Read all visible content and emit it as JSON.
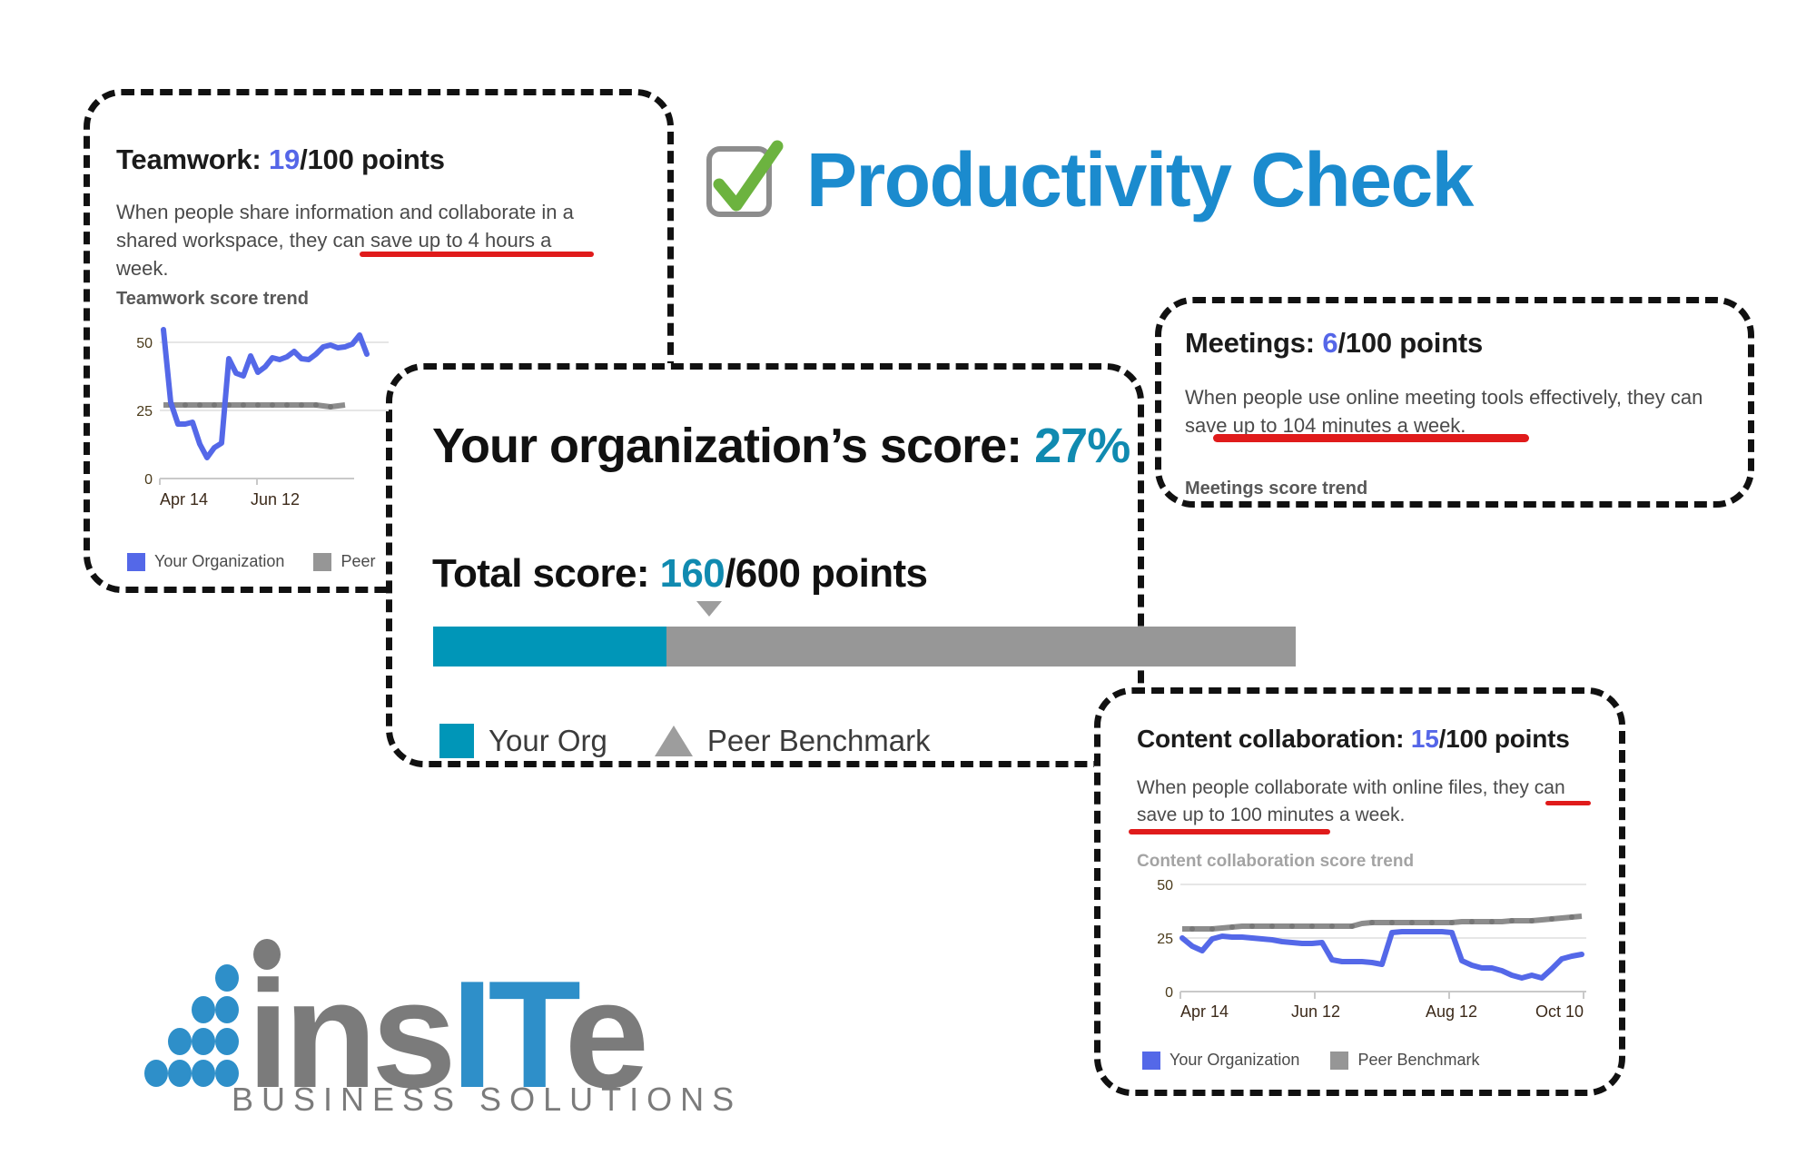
{
  "header": {
    "title": "Productivity Check",
    "title_color": "#1b8bce",
    "check_icon": "checkbox-checked-icon"
  },
  "logo": {
    "name_part1": "ins",
    "name_part2": "IT",
    "name_part3": "e",
    "tagline": "BUSINESS SOLUTIONS",
    "brand_blue": "#2e8fc9",
    "brand_gray": "#7b7b7b"
  },
  "score_panel": {
    "org_score_label": "Your organization’s score:",
    "org_score_value": "27%",
    "total_score_label": "Total score:",
    "total_score_value": "160",
    "total_score_max": "/600 points",
    "bar_fill_percent": 27,
    "bar_marker_percent": 32,
    "bar_fill_color": "#0096b8",
    "bar_rest_color": "#979797",
    "legend": [
      {
        "icon": "square-swatch-icon",
        "label": "Your Org"
      },
      {
        "icon": "triangle-marker-icon",
        "label": "Peer Benchmark"
      }
    ]
  },
  "metrics": [
    {
      "id": "teamwork",
      "title": "Teamwork:",
      "score": "19",
      "max": "/100 points",
      "body_pre": "When people share information and collaborate in a shared workspace, they can ",
      "body_highlight": "save up to 4 hours a week.",
      "trend_label": "Teamwork score trend",
      "legend": [
        {
          "icon": "blue-swatch-icon",
          "label": "Your Organization"
        },
        {
          "icon": "gray-swatch-icon",
          "label": "Peer"
        }
      ]
    },
    {
      "id": "meetings",
      "title": "Meetings:",
      "score": "6",
      "max": "/100 points",
      "body_pre": "When people use online meeting tools effectively, they can save up to ",
      "body_highlight": "104 minutes a week.",
      "trend_label": "Meetings score trend",
      "legend": []
    },
    {
      "id": "content",
      "title": "Content collaboration:",
      "score": "15",
      "max": "/100 points",
      "body_pre": "When people collaborate with online files, they can ",
      "body_highlight": "save up to 100 minutes a week.",
      "trend_label": "Content collaboration score trend",
      "legend": [
        {
          "icon": "blue-swatch-icon",
          "label": "Your Organization"
        },
        {
          "icon": "gray-swatch-icon",
          "label": "Peer Benchmark"
        }
      ]
    }
  ],
  "chart_data": [
    {
      "id": "teamwork-trend",
      "type": "line",
      "title": "Teamwork score trend",
      "xlabel": "",
      "ylabel": "",
      "ylim": [
        0,
        60
      ],
      "yticks": [
        0,
        25,
        50
      ],
      "grid": true,
      "legend_position": "bottom",
      "x_tick_labels": [
        "Apr 14",
        "Jun 12"
      ],
      "x_tick_positions": [
        0,
        13
      ],
      "series": [
        {
          "name": "Your Organization",
          "color": "#5468e8",
          "values": [
            56,
            28,
            20,
            20,
            20,
            14,
            8,
            13,
            15,
            44,
            39,
            38,
            45,
            39,
            41,
            45,
            44,
            45,
            47,
            44,
            44,
            46,
            49,
            50,
            49,
            49,
            50,
            54,
            47
          ]
        },
        {
          "name": "Peer Benchmark",
          "color": "#8c8c8c",
          "values": [
            27,
            27,
            27,
            27,
            27,
            27,
            27,
            27,
            27,
            27,
            27,
            27,
            27,
            27,
            27,
            27,
            27,
            27,
            27,
            27,
            27,
            27,
            27,
            27,
            27,
            27,
            27,
            27,
            27
          ]
        }
      ]
    },
    {
      "id": "content-trend",
      "type": "line",
      "title": "Content collaboration score trend",
      "xlabel": "",
      "ylabel": "",
      "ylim": [
        0,
        55
      ],
      "yticks": [
        0,
        25,
        50
      ],
      "grid": true,
      "legend_position": "bottom",
      "x_tick_labels": [
        "Apr 14",
        "Jun 12",
        "Aug 12",
        "Oct 10"
      ],
      "x_tick_positions": [
        0,
        11,
        22,
        32
      ],
      "series": [
        {
          "name": "Your Organization",
          "color": "#5468e8",
          "values": [
            25,
            21,
            18,
            24,
            26,
            25,
            25,
            25,
            25,
            25,
            23,
            22,
            22,
            22,
            23,
            15,
            14,
            14,
            14,
            14,
            13,
            27,
            28,
            28,
            28,
            28,
            28,
            28,
            15,
            13,
            12,
            12,
            11,
            9,
            8,
            9,
            8,
            11,
            14,
            15,
            16,
            16
          ]
        },
        {
          "name": "Peer Benchmark",
          "color": "#8c8c8c",
          "values": [
            29,
            29,
            29,
            29,
            29,
            29,
            30,
            30,
            30,
            30,
            30,
            30,
            30,
            30,
            30,
            30,
            30,
            30,
            30,
            30,
            30,
            31,
            32,
            32,
            32,
            32,
            32,
            32,
            32,
            32,
            32,
            32,
            32,
            32,
            32,
            32,
            32,
            32,
            33,
            33,
            33,
            33
          ]
        }
      ]
    }
  ]
}
